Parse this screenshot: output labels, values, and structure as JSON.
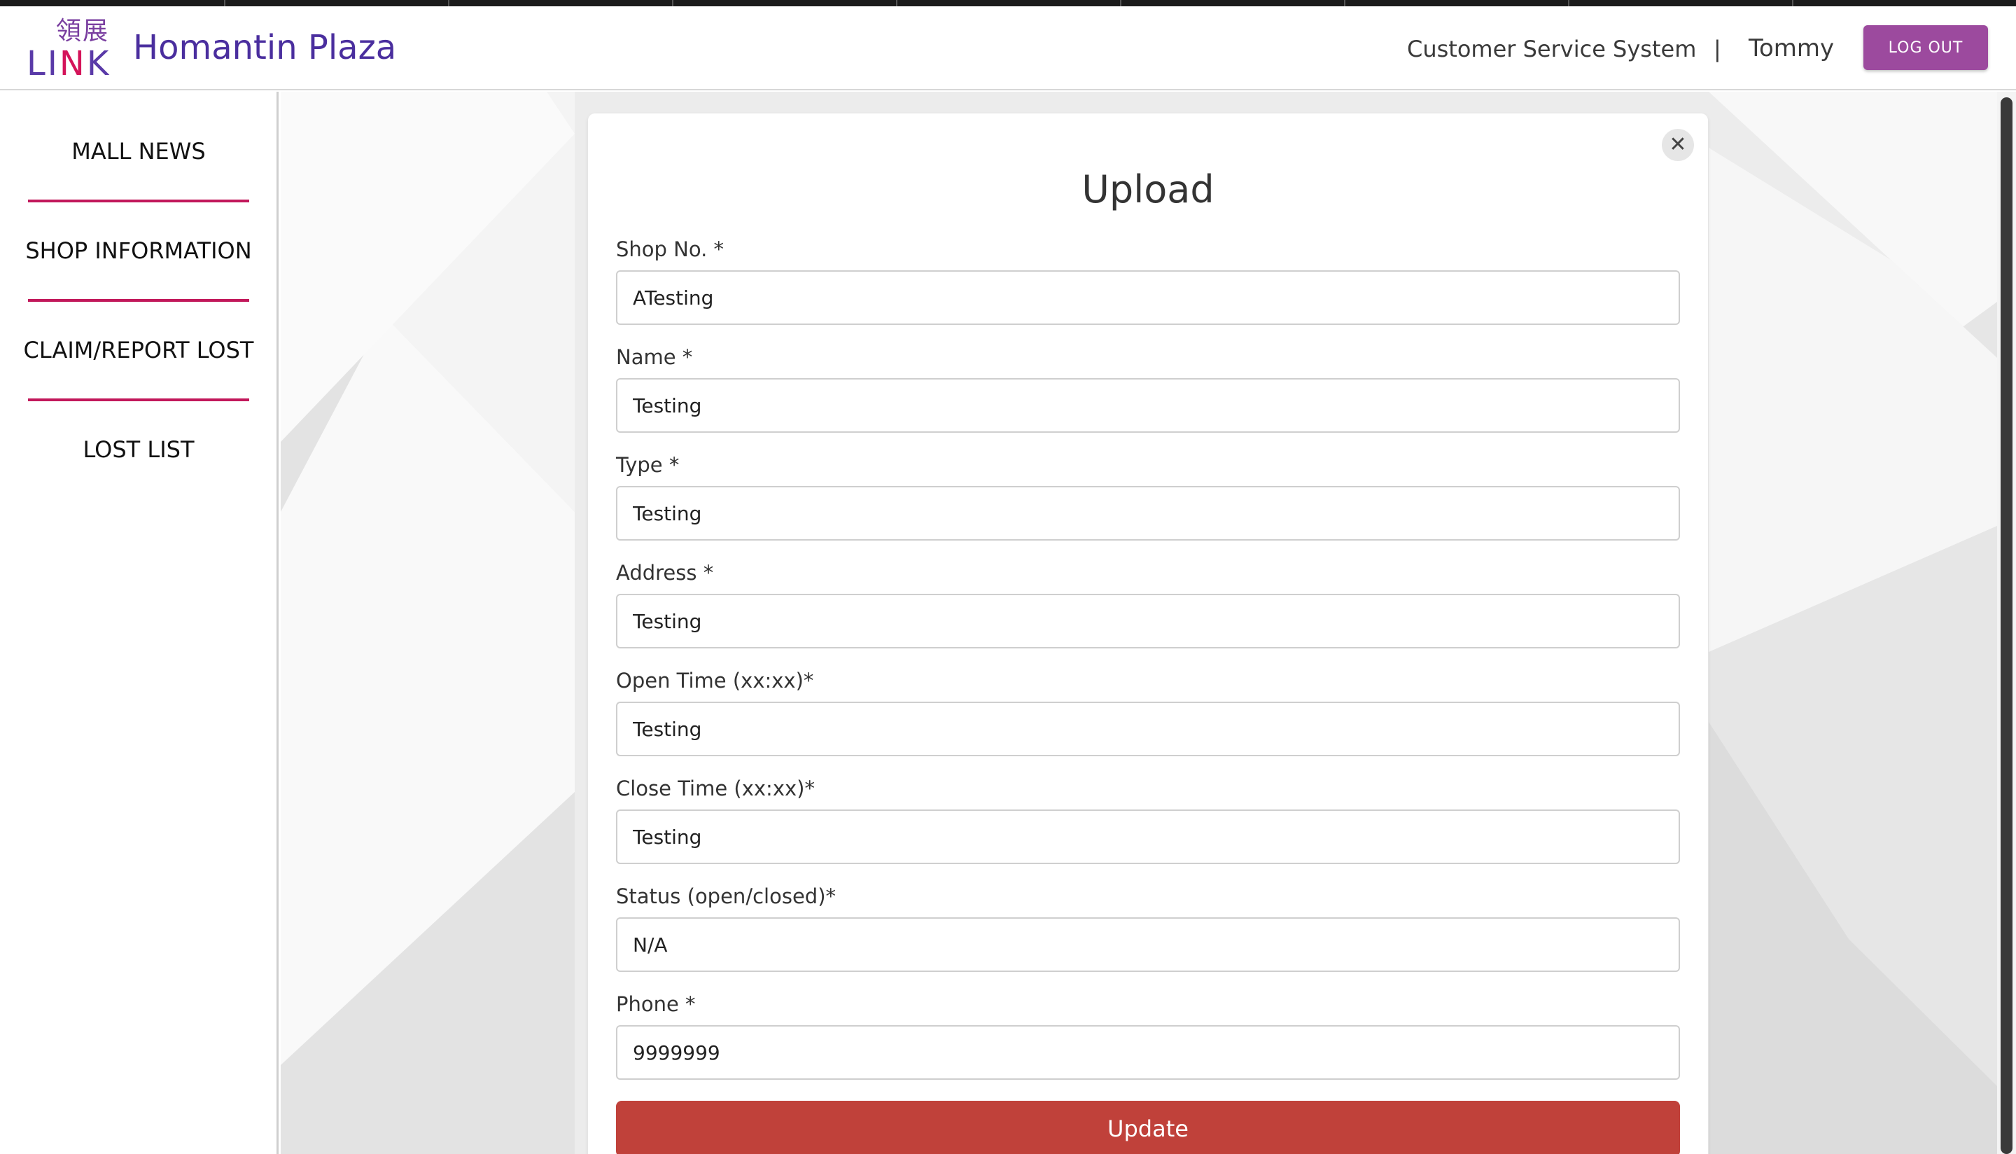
{
  "header": {
    "logo_cjk": "領展",
    "logo_word_a": "LI",
    "logo_word_b": "N",
    "logo_word_c": "K",
    "site_title": "Homantin Plaza",
    "system_name": "Customer Service System",
    "separator": "|",
    "user_name": "Tommy",
    "logout_label": "LOG OUT"
  },
  "sidebar": {
    "items": [
      {
        "label": "MALL NEWS"
      },
      {
        "label": "SHOP INFORMATION"
      },
      {
        "label": "CLAIM/REPORT LOST"
      },
      {
        "label": "LOST LIST"
      }
    ]
  },
  "modal": {
    "title": "Upload",
    "close_icon": "close-icon",
    "fields": [
      {
        "label": "Shop No. *",
        "value": "ATesting"
      },
      {
        "label": "Name *",
        "value": "Testing"
      },
      {
        "label": "Type *",
        "value": "Testing"
      },
      {
        "label": "Address *",
        "value": "Testing"
      },
      {
        "label": "Open Time (xx:xx)*",
        "value": "Testing"
      },
      {
        "label": "Close Time (xx:xx)*",
        "value": "Testing"
      },
      {
        "label": "Status (open/closed)*",
        "value": "N/A"
      },
      {
        "label": "Phone *",
        "value": "9999999"
      }
    ],
    "submit_label": "Update"
  },
  "colors": {
    "brand_purple": "#4a2e9e",
    "logout_button": "#9c4a9e",
    "nav_divider": "#c2185b",
    "update_button": "#c0413a"
  }
}
